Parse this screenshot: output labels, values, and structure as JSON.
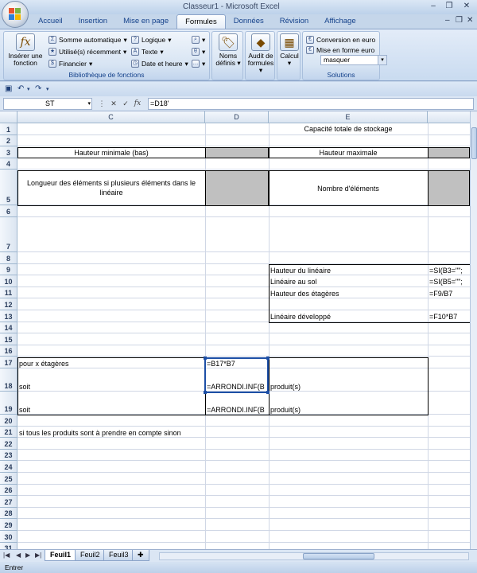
{
  "window": {
    "title": "Classeur1 - Microsoft Excel",
    "minimize": "–",
    "restore": "❐",
    "close": "✕"
  },
  "tabs": [
    "Accueil",
    "Insertion",
    "Mise en page",
    "Formules",
    "Données",
    "Révision",
    "Affichage"
  ],
  "active_tab": "Formules",
  "ribbon": {
    "insert_function": "Insérer une fonction",
    "library": {
      "autosum": "Somme automatique",
      "recent": "Utilisé(s) récemment",
      "financial": "Financier",
      "logical": "Logique",
      "text": "Texte",
      "datetime": "Date et heure",
      "label": "Bibliothèque de fonctions"
    },
    "names": "Noms définis",
    "audit": "Audit de formules",
    "calc": "Calcul",
    "solutions": {
      "conversion": "Conversion en euro",
      "format": "Mise en forme euro",
      "combo": "masquer",
      "label": "Solutions"
    }
  },
  "formula_bar": {
    "name_box": "ST",
    "formula": "=D18'"
  },
  "columns": {
    "C": "C",
    "D": "D",
    "E": "E"
  },
  "rows": [
    "1",
    "2",
    "3",
    "4",
    "5",
    "6",
    "7",
    "8",
    "9",
    "10",
    "11",
    "12",
    "13",
    "14",
    "15",
    "16",
    "17",
    "18",
    "19",
    "20",
    "21",
    "22",
    "23",
    "24",
    "25",
    "26",
    "27",
    "28",
    "29",
    "30",
    "31"
  ],
  "cells": {
    "E1": "Capacité totale de stockage",
    "C3": "Hauteur minimale (bas)",
    "E3": "Hauteur maximale",
    "C5": "Longueur des éléments si plusieurs éléments dans le linéaire",
    "E5": "Nombre d'éléments",
    "E9": "Hauteur du linéaire",
    "F9": "=SI(B3=\"\";",
    "E10": "Linéaire au sol",
    "F10": "=SI(B5=\"\";",
    "E11": "Hauteur des étagères",
    "F11": "=F9/B7",
    "E13": "Linéaire développé",
    "F13": "=F10*B7",
    "C17": "pour x étagères",
    "D17": "=B17*B7",
    "C18": "soit",
    "D18": "=ARRONDI.INF(B",
    "E18": "produit(s)",
    "C19": "soit",
    "D19": "=ARRONDI.INF(B",
    "E19": "produit(s)",
    "C21": "si tous les produits sont à prendre en compte sinon"
  },
  "sheets": [
    "Feuil1",
    "Feuil2",
    "Feuil3"
  ],
  "status": "Entrer"
}
